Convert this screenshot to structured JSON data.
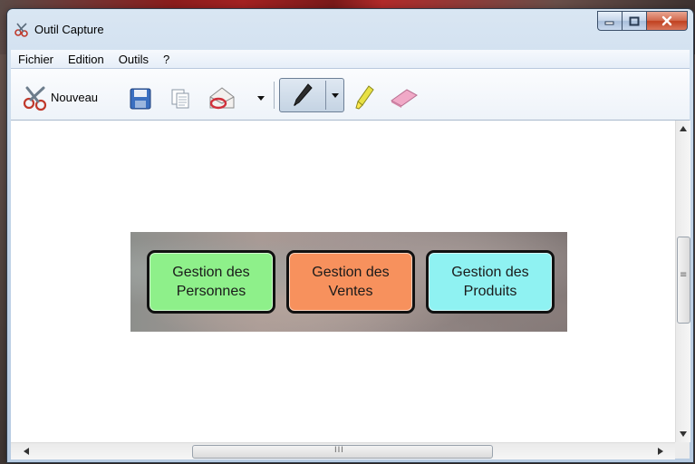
{
  "window": {
    "title": "Outil Capture"
  },
  "menu": [
    "Fichier",
    "Edition",
    "Outils",
    "?"
  ],
  "toolbar": {
    "new_label": "Nouveau"
  },
  "capture": {
    "buttons": [
      {
        "line1": "Gestion des",
        "line2": "Personnes",
        "color": "#8ef08a"
      },
      {
        "line1": "Gestion des",
        "line2": "Ventes",
        "color": "#f7915d"
      },
      {
        "line1": "Gestion des",
        "line2": "Produits",
        "color": "#8ff2f2"
      }
    ]
  },
  "scrollbar": {
    "h_thumb_glyph": "III",
    "v_thumb_glyph": "≡"
  },
  "icons": {
    "app": "scissors-icon",
    "new": "scissors-icon",
    "save": "floppy-disk-icon",
    "copy": "copy-icon",
    "send": "envelope-icon",
    "pen": "pen-icon",
    "highlighter": "highlighter-icon",
    "eraser": "eraser-icon"
  }
}
